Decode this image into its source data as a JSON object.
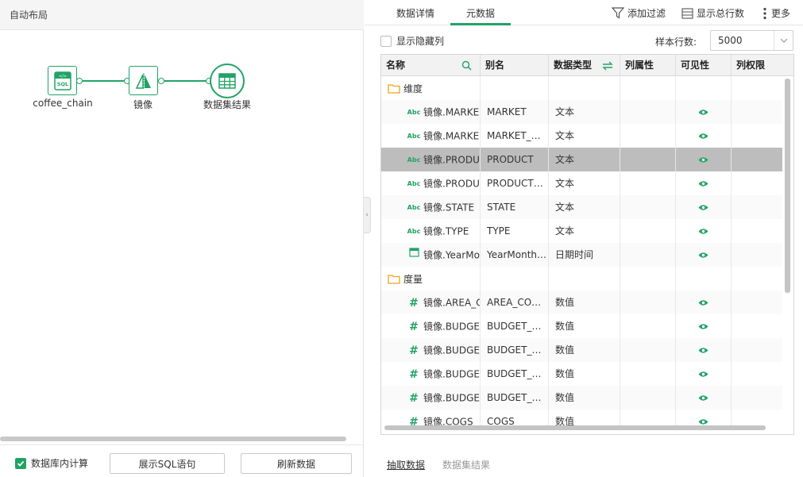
{
  "left_panel": {
    "header": "自动布局",
    "nodes": [
      {
        "label": "coffee_chain",
        "icon": "sql-file-icon",
        "icon_text": "SQL"
      },
      {
        "label": "镜像",
        "icon": "mirror-icon"
      },
      {
        "label": "数据集结果",
        "icon": "table-grid-icon"
      }
    ],
    "footer": {
      "db_compute_label": "数据库内计算",
      "db_compute_checked": true,
      "show_sql_label": "展示SQL语句",
      "refresh_label": "刷新数据"
    }
  },
  "right_panel": {
    "tabs": [
      {
        "label": "数据详情",
        "active": false
      },
      {
        "label": "元数据",
        "active": true
      }
    ],
    "toolbar": {
      "add_filter": "添加过滤",
      "show_total_rows": "显示总行数",
      "more": "更多"
    },
    "options": {
      "show_hidden_cols": "显示隐藏列",
      "show_hidden_checked": false,
      "sample_rows_label": "样本行数:",
      "sample_rows_value": "5000"
    },
    "table": {
      "headers": [
        "名称",
        "别名",
        "数据类型",
        "列属性",
        "可见性",
        "列权限"
      ],
      "rows": [
        {
          "kind": "group",
          "icon": "folder-icon",
          "name": "维度"
        },
        {
          "kind": "field",
          "icon": "text-field-icon",
          "icon_text": "Abc",
          "name": "镜像.MARKE",
          "alias": "MARKET",
          "type": "文本",
          "visible": true
        },
        {
          "kind": "field",
          "icon": "text-field-icon",
          "icon_text": "Abc",
          "name": "镜像.MARKE",
          "alias": "MARKET_…",
          "type": "文本",
          "visible": true
        },
        {
          "kind": "field",
          "icon": "text-field-icon",
          "icon_text": "Abc",
          "name": "镜像.PRODU",
          "alias": "PRODUCT",
          "type": "文本",
          "visible": true,
          "selected": true
        },
        {
          "kind": "field",
          "icon": "text-field-icon",
          "icon_text": "Abc",
          "name": "镜像.PRODU",
          "alias": "PRODUCT…",
          "type": "文本",
          "visible": true
        },
        {
          "kind": "field",
          "icon": "text-field-icon",
          "icon_text": "Abc",
          "name": "镜像.STATE",
          "alias": "STATE",
          "type": "文本",
          "visible": true
        },
        {
          "kind": "field",
          "icon": "text-field-icon",
          "icon_text": "Abc",
          "name": "镜像.TYPE",
          "alias": "TYPE",
          "type": "文本",
          "visible": true
        },
        {
          "kind": "field",
          "icon": "calendar-icon",
          "name": "镜像.YearMo",
          "alias": "YearMonth…",
          "type": "日期时间",
          "visible": true
        },
        {
          "kind": "group",
          "icon": "folder-icon",
          "name": "度量"
        },
        {
          "kind": "field",
          "icon": "number-field-icon",
          "icon_text": "#",
          "name": "镜像.AREA_C",
          "alias": "AREA_CO…",
          "type": "数值",
          "visible": true
        },
        {
          "kind": "field",
          "icon": "number-field-icon",
          "icon_text": "#",
          "name": "镜像.BUDGE",
          "alias": "BUDGET_…",
          "type": "数值",
          "visible": true
        },
        {
          "kind": "field",
          "icon": "number-field-icon",
          "icon_text": "#",
          "name": "镜像.BUDGE",
          "alias": "BUDGET_…",
          "type": "数值",
          "visible": true
        },
        {
          "kind": "field",
          "icon": "number-field-icon",
          "icon_text": "#",
          "name": "镜像.BUDGE",
          "alias": "BUDGET_…",
          "type": "数值",
          "visible": true
        },
        {
          "kind": "field",
          "icon": "number-field-icon",
          "icon_text": "#",
          "name": "镜像.BUDGE",
          "alias": "BUDGET_…",
          "type": "数值",
          "visible": true
        },
        {
          "kind": "field",
          "icon": "number-field-icon",
          "icon_text": "#",
          "name": "镜像.COGS",
          "alias": "COGS",
          "type": "数值",
          "visible": true
        }
      ]
    },
    "bottom_links": {
      "extract": "抽取数据",
      "dataset_result": "数据集结果"
    }
  },
  "colors": {
    "accent": "#21a366",
    "folder": "#f0a020",
    "selected_row": "#bdbdbd"
  }
}
